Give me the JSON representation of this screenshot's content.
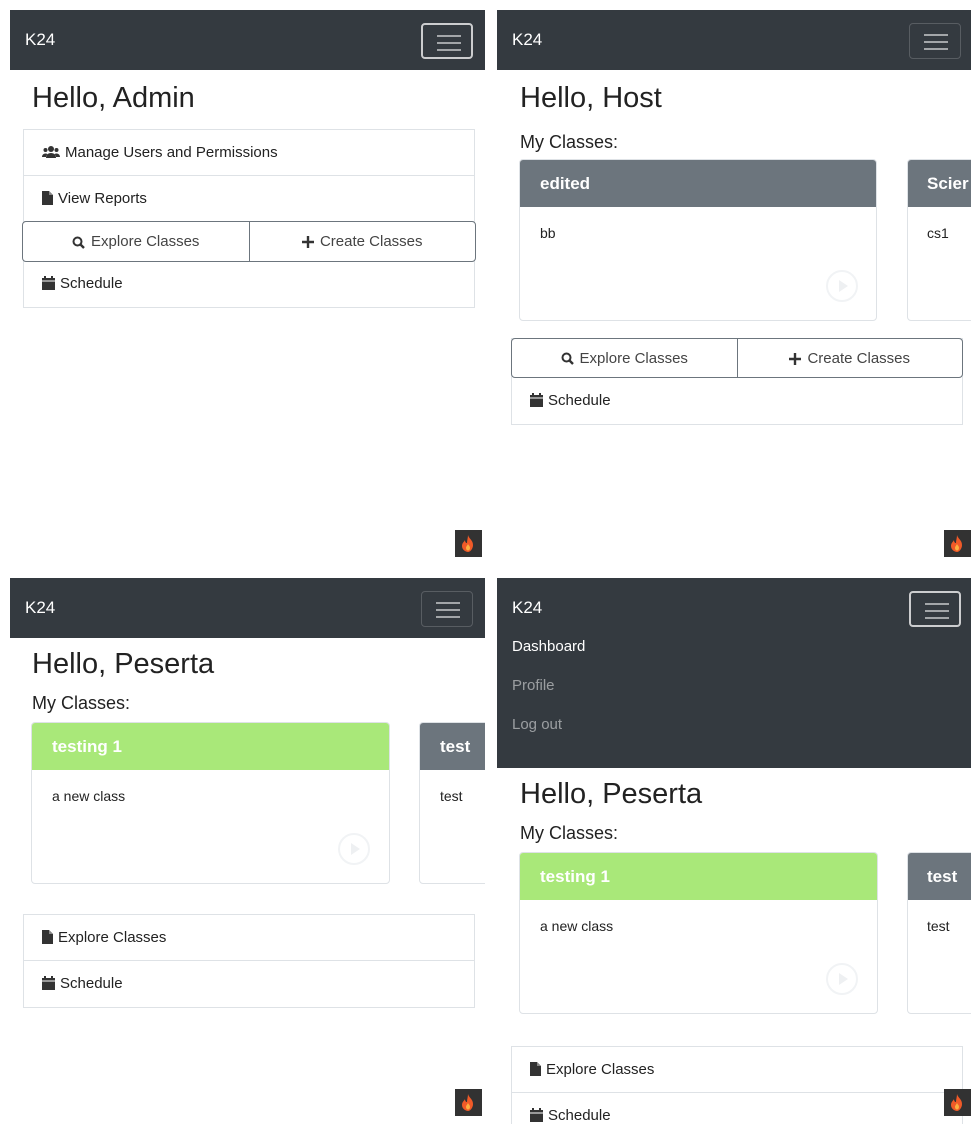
{
  "brand": "K24",
  "panel_admin": {
    "greeting": "Hello, Admin",
    "items": {
      "manage": "Manage Users and Permissions",
      "reports": "View Reports",
      "explore": "Explore Classes",
      "create": "Create Classes",
      "schedule": "Schedule"
    }
  },
  "panel_host": {
    "greeting": "Hello, Host",
    "my_classes": "My Classes:",
    "cards": [
      {
        "title": "edited",
        "desc": "bb"
      },
      {
        "title": "Scier",
        "desc": "cs1"
      }
    ],
    "explore": "Explore Classes",
    "create": "Create Classes",
    "schedule": "Schedule"
  },
  "panel_peserta": {
    "greeting": "Hello, Peserta",
    "my_classes": "My Classes:",
    "cards": [
      {
        "title": "testing 1",
        "desc": "a new class"
      },
      {
        "title": "test",
        "desc": "test"
      }
    ],
    "explore": "Explore Classes",
    "schedule": "Schedule"
  },
  "panel_peserta_menu": {
    "menu": {
      "dashboard": "Dashboard",
      "profile": "Profile",
      "logout": "Log out"
    },
    "greeting": "Hello, Peserta",
    "my_classes": "My Classes:",
    "cards": [
      {
        "title": "testing 1",
        "desc": "a new class"
      },
      {
        "title": "test",
        "desc": "test"
      }
    ],
    "explore": "Explore Classes",
    "schedule": "Schedule"
  },
  "colors": {
    "navbar": "#343a40",
    "card_header_gray": "#6c757d",
    "card_header_green": "#a9e879",
    "fire_badge": "#323232"
  },
  "icons": [
    "users-icon",
    "file-icon",
    "search-icon",
    "plus-icon",
    "calendar-icon",
    "play-circle-icon",
    "fire-icon",
    "hamburger-icon"
  ]
}
